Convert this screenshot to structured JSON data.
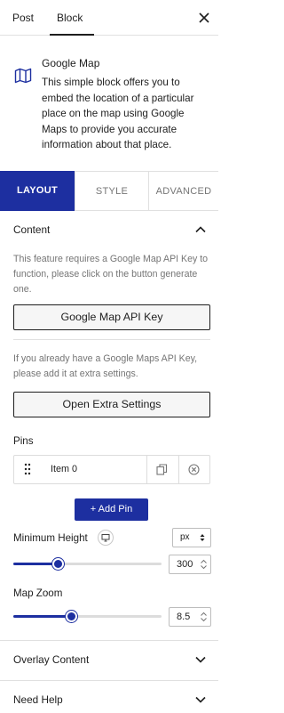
{
  "header": {
    "tabs": [
      {
        "label": "Post"
      },
      {
        "label": "Block"
      }
    ]
  },
  "block": {
    "title": "Google Map",
    "description": "This simple block offers you to embed the location of a particular place on the map using Google Maps to provide you accurate information about that place."
  },
  "panel_tabs": [
    {
      "label": "LAYOUT",
      "active": true
    },
    {
      "label": "STYLE"
    },
    {
      "label": "ADVANCED"
    }
  ],
  "content": {
    "title": "Content",
    "api_help": "This feature requires a Google Map API Key to function, please click on the button generate one.",
    "api_button": "Google Map API Key",
    "extra_help": "If you already have a Google Maps API Key, please add it at extra settings.",
    "extra_button": "Open Extra Settings",
    "pins_label": "Pins",
    "pins": [
      {
        "label": "Item 0"
      }
    ],
    "add_pin_label": "+ Add Pin",
    "min_height": {
      "label": "Minimum Height",
      "unit": "px",
      "value": "300",
      "max": 1000
    },
    "map_zoom": {
      "label": "Map Zoom",
      "value": "8.5",
      "max": 22
    }
  },
  "sections": {
    "overlay": "Overlay Content",
    "help": "Need Help"
  },
  "colors": {
    "accent": "#1d2fa0"
  },
  "icons": {
    "close": "close-icon",
    "map": "map-icon",
    "chevron_up": "chevron-up-icon",
    "chevron_down": "chevron-down-icon",
    "drag": "drag-handle-icon",
    "copy": "copy-icon",
    "delete": "delete-icon",
    "device": "monitor-icon"
  }
}
